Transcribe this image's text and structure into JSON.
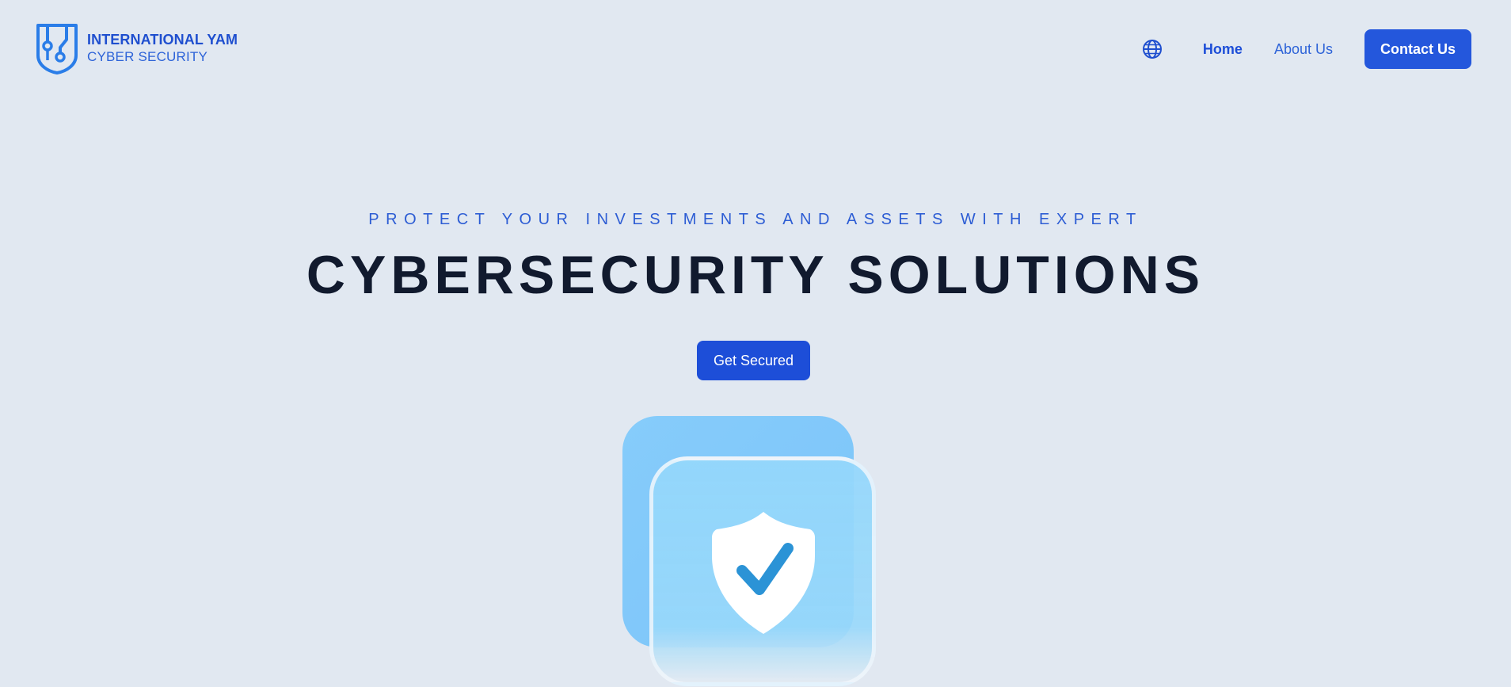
{
  "brand": {
    "name_line1": "INTERNATIONAL YAM",
    "name_line2": "CYBER SECURITY",
    "logo_icon": "shield-circuit-logo",
    "color": "#1f4fcf"
  },
  "nav": {
    "language_icon": "globe-icon",
    "home_label": "Home",
    "about_label": "About Us",
    "contact_label": "Contact Us"
  },
  "hero": {
    "eyebrow": "PROTECT YOUR INVESTMENTS AND ASSETS WITH EXPERT",
    "title": "CYBERSECURITY SOLUTIONS",
    "cta_label": "Get Secured",
    "illustration_icon": "shield-check-icon"
  },
  "colors": {
    "background": "#e1e8f1",
    "accent": "#1d4ed8",
    "title": "#111a2e",
    "card_blue": "#86ccfb"
  }
}
